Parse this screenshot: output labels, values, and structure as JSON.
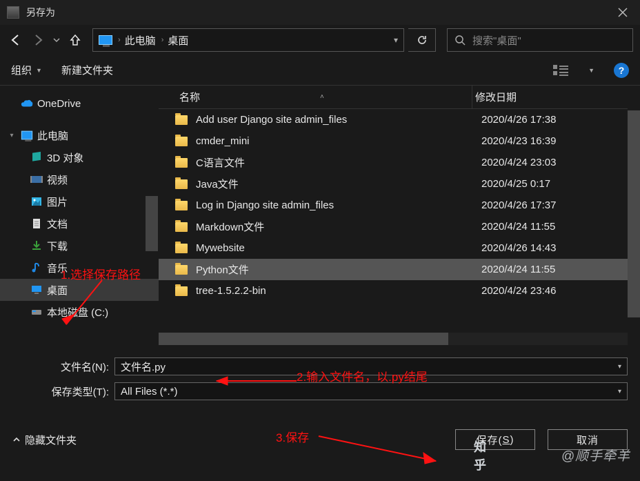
{
  "title": "另存为",
  "breadcrumb": {
    "root": "此电脑",
    "current": "桌面"
  },
  "search": {
    "placeholder": "搜索\"桌面\""
  },
  "toolbar": {
    "organize": "组织",
    "newfolder": "新建文件夹"
  },
  "columns": {
    "name": "名称",
    "date": "修改日期"
  },
  "sidebar": {
    "onedrive": "OneDrive",
    "thispc": "此电脑",
    "children": [
      "3D 对象",
      "视频",
      "图片",
      "文档",
      "下载",
      "音乐",
      "桌面",
      "本地磁盘 (C:)"
    ]
  },
  "files": [
    {
      "n": "Add user   Django site admin_files",
      "d": "2020/4/26 17:38"
    },
    {
      "n": "cmder_mini",
      "d": "2020/4/23 16:39"
    },
    {
      "n": "C语言文件",
      "d": "2020/4/24 23:03"
    },
    {
      "n": "Java文件",
      "d": "2020/4/25 0:17"
    },
    {
      "n": "Log in   Django site admin_files",
      "d": "2020/4/26 17:37"
    },
    {
      "n": "Markdown文件",
      "d": "2020/4/24 11:55"
    },
    {
      "n": "Mywebsite",
      "d": "2020/4/26 14:43"
    },
    {
      "n": "Python文件",
      "d": "2020/4/24 11:55"
    },
    {
      "n": "tree-1.5.2.2-bin",
      "d": "2020/4/24 23:46"
    }
  ],
  "selected_row": 7,
  "form": {
    "fname_label": "文件名(N):",
    "fname_value": "文件名.py",
    "ftype_label": "保存类型(T):",
    "ftype_value": "All Files (*.*)"
  },
  "footer": {
    "hide": "隐藏文件夹",
    "save_text": "保存(",
    "save_accel": "S",
    "save_tail": ")",
    "cancel": "取消"
  },
  "annot": {
    "a1": "1.选择保存路径",
    "a2": "2.输入文件名，以.py结尾",
    "a3": "3.保存"
  },
  "watermark": "@顺手牵羊",
  "zhihu": "知乎"
}
